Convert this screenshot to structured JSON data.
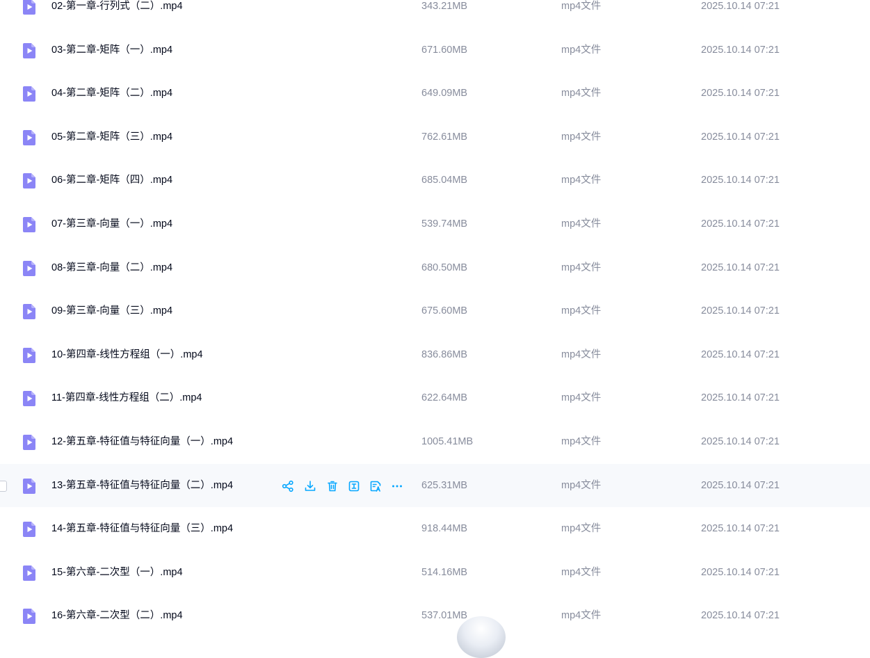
{
  "colors": {
    "accent": "#06a7ff",
    "icon_purple": "#8b85f6",
    "muted_text": "#878c9c",
    "hover_row": "#f7f9fc"
  },
  "row_icon": "video-file-icon",
  "files": [
    {
      "name": "02-第一章-行列式（二）.mp4",
      "size": "343.21MB",
      "type": "mp4文件",
      "date": "2025.10.14 07:21"
    },
    {
      "name": "03-第二章-矩阵（一）.mp4",
      "size": "671.60MB",
      "type": "mp4文件",
      "date": "2025.10.14 07:21"
    },
    {
      "name": "04-第二章-矩阵（二）.mp4",
      "size": "649.09MB",
      "type": "mp4文件",
      "date": "2025.10.14 07:21"
    },
    {
      "name": "05-第二章-矩阵（三）.mp4",
      "size": "762.61MB",
      "type": "mp4文件",
      "date": "2025.10.14 07:21"
    },
    {
      "name": "06-第二章-矩阵（四）.mp4",
      "size": "685.04MB",
      "type": "mp4文件",
      "date": "2025.10.14 07:21"
    },
    {
      "name": "07-第三章-向量（一）.mp4",
      "size": "539.74MB",
      "type": "mp4文件",
      "date": "2025.10.14 07:21"
    },
    {
      "name": "08-第三章-向量（二）.mp4",
      "size": "680.50MB",
      "type": "mp4文件",
      "date": "2025.10.14 07:21"
    },
    {
      "name": "09-第三章-向量（三）.mp4",
      "size": "675.60MB",
      "type": "mp4文件",
      "date": "2025.10.14 07:21"
    },
    {
      "name": "10-第四章-线性方程组（一）.mp4",
      "size": "836.86MB",
      "type": "mp4文件",
      "date": "2025.10.14 07:21"
    },
    {
      "name": "11-第四章-线性方程组（二）.mp4",
      "size": "622.64MB",
      "type": "mp4文件",
      "date": "2025.10.14 07:21"
    },
    {
      "name": "12-第五章-特征值与特征向量（一）.mp4",
      "size": "1005.41MB",
      "type": "mp4文件",
      "date": "2025.10.14 07:21"
    },
    {
      "name": "13-第五章-特征值与特征向量（二）.mp4",
      "size": "625.31MB",
      "type": "mp4文件",
      "date": "2025.10.14 07:21",
      "hovered": true
    },
    {
      "name": "14-第五章-特征值与特征向量（三）.mp4",
      "size": "918.44MB",
      "type": "mp4文件",
      "date": "2025.10.14 07:21"
    },
    {
      "name": "15-第六章-二次型（一）.mp4",
      "size": "514.16MB",
      "type": "mp4文件",
      "date": "2025.10.14 07:21"
    },
    {
      "name": "16-第六章-二次型（二）.mp4",
      "size": "537.01MB",
      "type": "mp4文件",
      "date": "2025.10.14 07:21"
    }
  ],
  "row_actions": [
    {
      "name": "share-icon"
    },
    {
      "name": "download-icon"
    },
    {
      "name": "delete-icon"
    },
    {
      "name": "rename-icon"
    },
    {
      "name": "ai-text-icon"
    },
    {
      "name": "more-icon"
    }
  ]
}
